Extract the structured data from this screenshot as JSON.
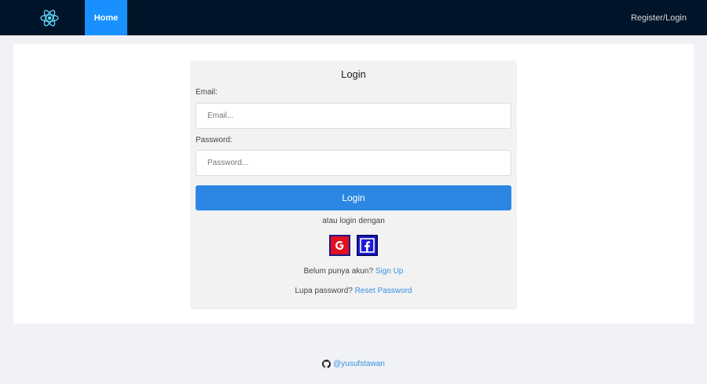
{
  "navbar": {
    "logo_icon": "react-atom-icon",
    "home_label": "Home",
    "register_label": "Register/Login"
  },
  "login": {
    "title": "Login",
    "email_label": "Email:",
    "email_placeholder": "Email...",
    "password_label": "Password:",
    "password_placeholder": "Password...",
    "button_label": "Login",
    "alt_text": "atau login dengan",
    "social": [
      {
        "name": "google-icon",
        "color": "#e0101e"
      },
      {
        "name": "facebook-icon",
        "color": "#1a1ad6"
      }
    ],
    "signup_prompt": "Belum punya akun?",
    "signup_link": "Sign Up",
    "reset_prompt": "Lupa password?",
    "reset_link": "Reset Password"
  },
  "footer": {
    "github_icon": "github-icon",
    "handle": "@yusufstawan"
  },
  "colors": {
    "navbar_bg": "#001529",
    "nav_active": "#1890ff",
    "button": "#2b87e3",
    "link": "#3a8fe0"
  }
}
